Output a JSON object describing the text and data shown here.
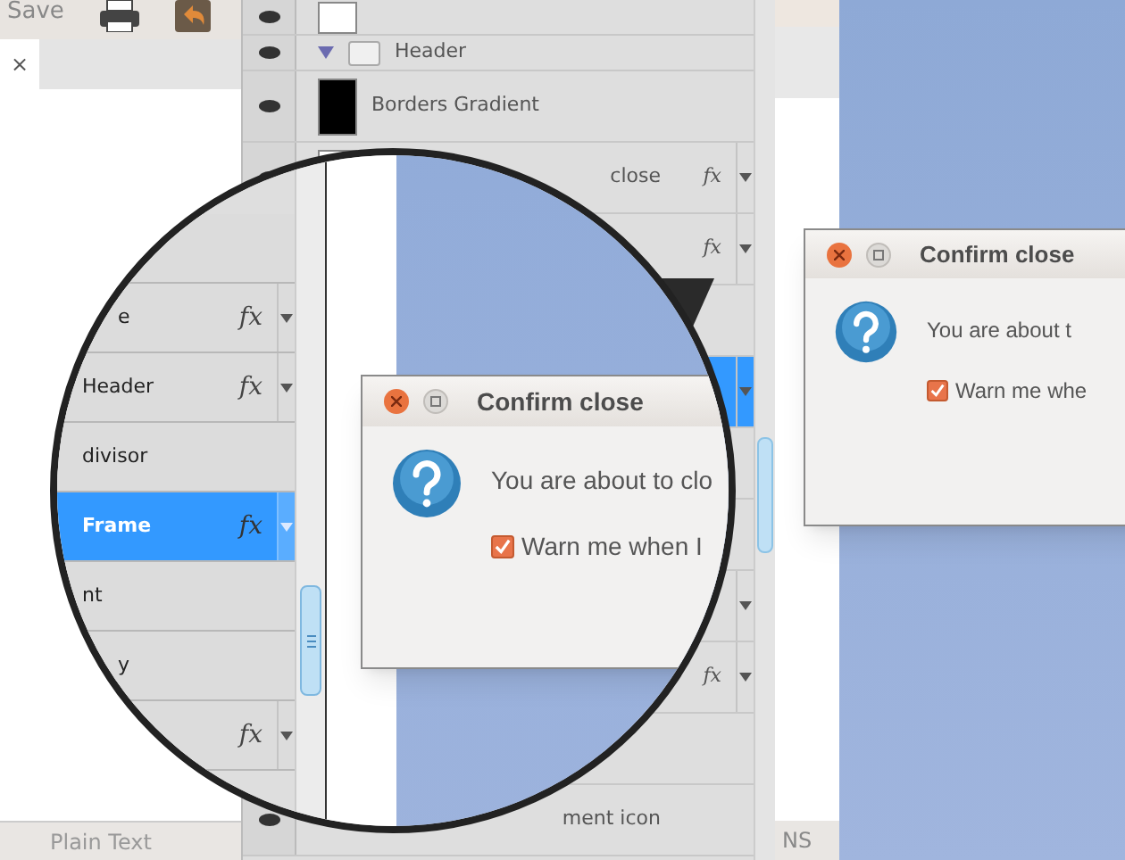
{
  "toolbar": {
    "save_label": "Save"
  },
  "document_tab": {
    "close_glyph": "×"
  },
  "layers": [
    {
      "kind": "layer",
      "color": "#ffffff",
      "dropdown": false,
      "selected": false
    },
    {
      "kind": "group",
      "label": "Header",
      "expanded": true,
      "dropdown": false,
      "selected": false
    },
    {
      "kind": "layer",
      "color": "#000000",
      "label": "Borders Gradient",
      "dropdown": false,
      "selected": false
    },
    {
      "kind": "tail",
      "color": "#ffffff",
      "label": "close",
      "fx": "fx",
      "dropdown": true,
      "selected": false
    },
    {
      "kind": "layer",
      "fx": "fx",
      "dropdown": true,
      "selected": false
    },
    {
      "kind": "layer",
      "dropdown": false,
      "selected": false
    },
    {
      "kind": "layer",
      "dropdown": true,
      "selected": true
    },
    {
      "kind": "layer",
      "dropdown": false,
      "selected": false
    },
    {
      "kind": "layer",
      "dropdown": false,
      "selected": false
    },
    {
      "kind": "layer",
      "dropdown": true,
      "selected": false
    },
    {
      "kind": "layer",
      "fx": "fx",
      "dropdown": true,
      "selected": false
    },
    {
      "kind": "layer",
      "dropdown": false,
      "selected": false
    },
    {
      "kind": "tail",
      "label": "ment icon",
      "dropdown": false,
      "selected": false
    }
  ],
  "status_bar": {
    "left": "Plain Text",
    "right": "NS"
  },
  "dialog": {
    "title": "Confirm close",
    "message": "You are about t",
    "checkbox": {
      "label": "Warn me whe",
      "checked": true
    }
  },
  "magnifier": {
    "rows": [
      {
        "kind": "row",
        "dropdown": false,
        "selected": false
      },
      {
        "kind": "tail",
        "label": "e",
        "fx": "fx",
        "dropdown": true,
        "selected": false
      },
      {
        "kind": "row",
        "label": "Header",
        "fx": "fx",
        "dropdown": true,
        "selected": false
      },
      {
        "kind": "row",
        "label": "divisor",
        "dropdown": false,
        "selected": false
      },
      {
        "kind": "row",
        "label": "Frame",
        "fx": "fx",
        "dropdown": true,
        "selected": true
      },
      {
        "kind": "row",
        "label": "nt",
        "dropdown": false,
        "selected": false
      },
      {
        "kind": "tail",
        "label": "y",
        "dropdown": false,
        "selected": false
      },
      {
        "kind": "row",
        "fx": "fx",
        "dropdown": true,
        "selected": false
      }
    ],
    "dialog": {
      "title": "Confirm close",
      "message": "You are about to clo",
      "checkbox": {
        "label": "Warn me when I",
        "checked": true
      }
    }
  }
}
